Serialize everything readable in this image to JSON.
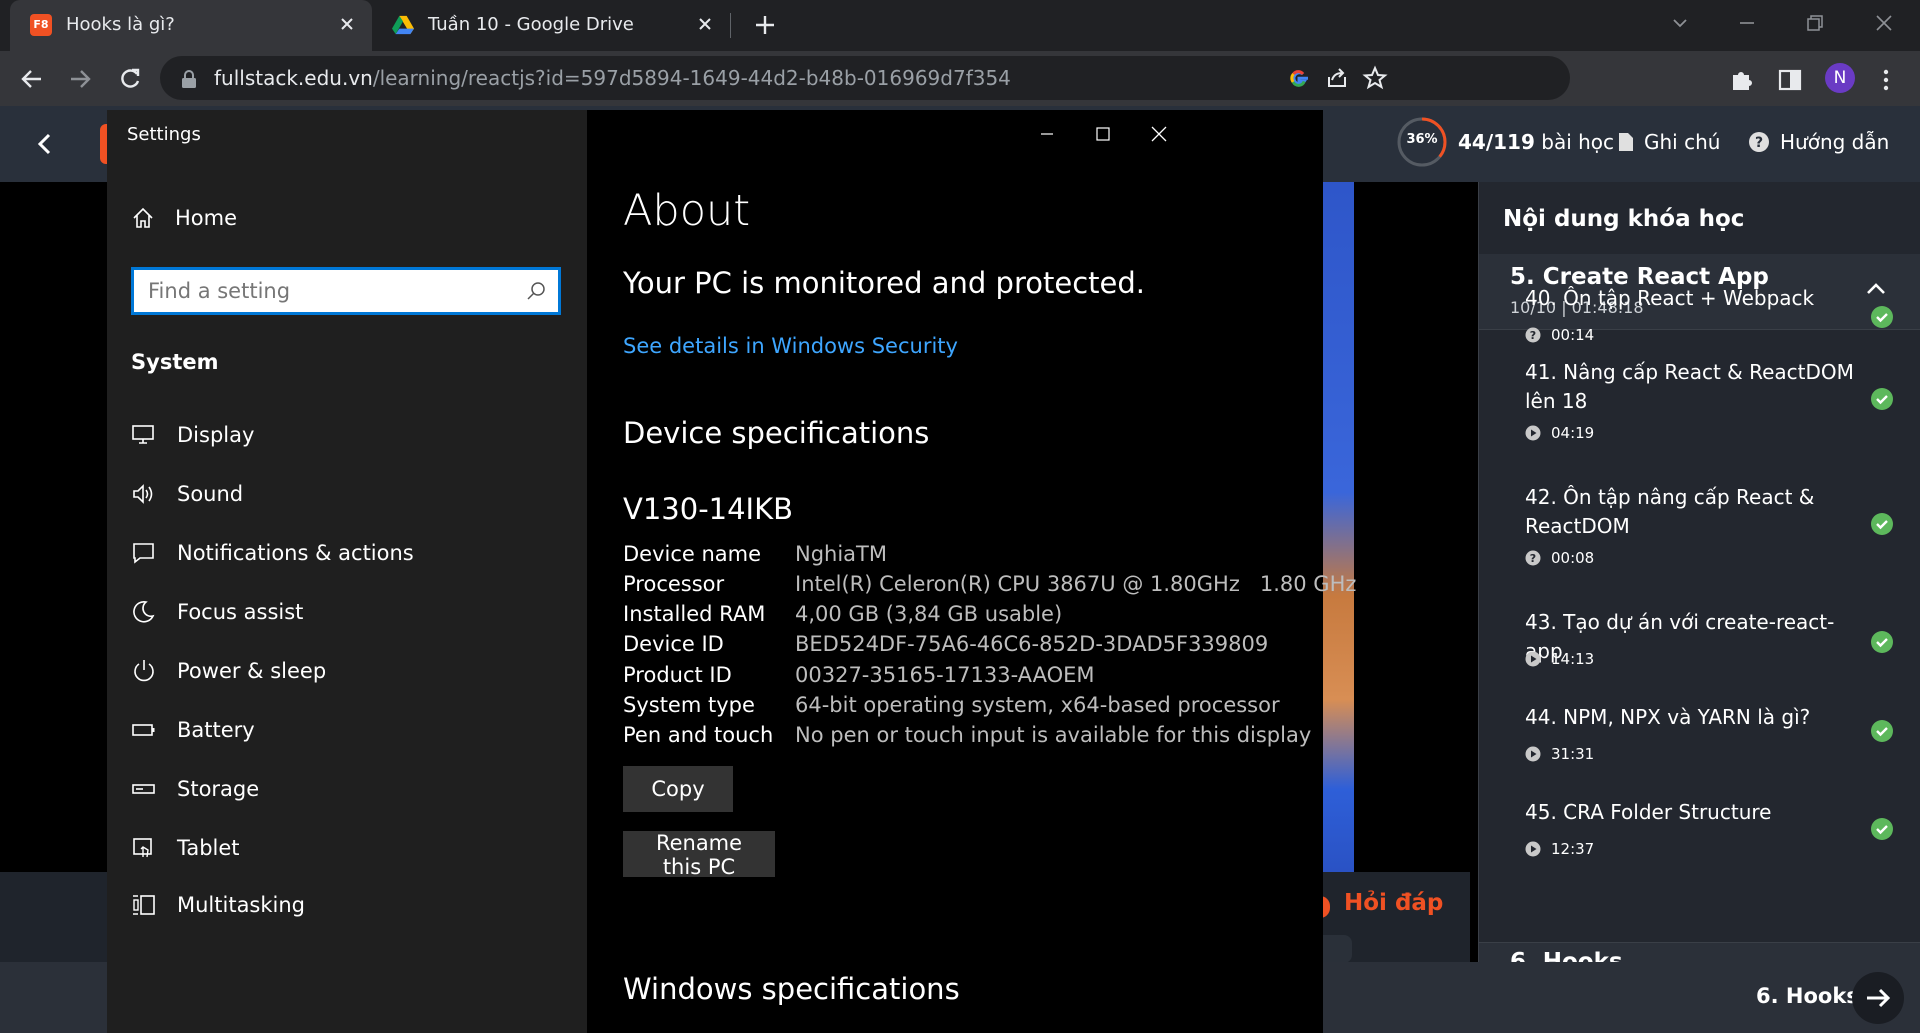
{
  "browser": {
    "tabs": [
      {
        "title": "Hooks là gì?",
        "favicon": "f8-favicon",
        "favicon_text": "F8",
        "active": true
      },
      {
        "title": "Tuần 10 - Google Drive",
        "favicon": "google-drive-favicon",
        "active": false
      }
    ],
    "url": {
      "host": "fullstack.edu.vn",
      "path": "/learning/reactjs?id=597d5894-1649-44d2-b48b-016969d7f354"
    },
    "profile_initial": "N"
  },
  "page": {
    "progress": {
      "percent_label": "36%",
      "percent": 36
    },
    "lesson_count": {
      "done": "44/119",
      "suffix": " bài học"
    },
    "header_links": {
      "notes": "Ghi chú",
      "guide": "Hướng dẫn"
    },
    "qa_label": "Hỏi đáp",
    "next_section_label": "6. Hooks",
    "course": {
      "title": "Nội dung khóa học",
      "section": {
        "name": "5. Create React App",
        "meta": "10/10 | 01:48:18"
      },
      "lessons": [
        {
          "title": "40. Ôn tập React + Webpack",
          "time": "00:14",
          "icon": "question-icon",
          "done": true
        },
        {
          "title": "41. Nâng cấp React & ReactDOM lên 18",
          "time": "04:19",
          "icon": "play-icon",
          "done": true
        },
        {
          "title": "42. Ôn tập nâng cấp React & ReactDOM",
          "time": "00:08",
          "icon": "question-icon",
          "done": true
        },
        {
          "title": "43. Tạo dự án với create-react-app",
          "time": "14:13",
          "icon": "play-icon",
          "done": true
        },
        {
          "title": "44. NPM, NPX và YARN là gì?",
          "time": "31:31",
          "icon": "play-icon",
          "done": true
        },
        {
          "title": "45. CRA Folder Structure",
          "time": "12:37",
          "icon": "play-icon",
          "done": true
        }
      ],
      "next_section_name": "6. Hooks"
    },
    "colors": {
      "brand": "#f05123",
      "check": "#5db85c",
      "link": "#3ea6ff",
      "accent": "#0078d7"
    }
  },
  "settings": {
    "app_title": "Settings",
    "home_label": "Home",
    "search_placeholder": "Find a setting",
    "section_label": "System",
    "nav_items": [
      {
        "label": "Display",
        "icon": "display-icon"
      },
      {
        "label": "Sound",
        "icon": "sound-icon"
      },
      {
        "label": "Notifications & actions",
        "icon": "notifications-icon"
      },
      {
        "label": "Focus assist",
        "icon": "focus-assist-icon"
      },
      {
        "label": "Power & sleep",
        "icon": "power-icon"
      },
      {
        "label": "Battery",
        "icon": "battery-icon"
      },
      {
        "label": "Storage",
        "icon": "storage-icon"
      },
      {
        "label": "Tablet",
        "icon": "tablet-icon"
      },
      {
        "label": "Multitasking",
        "icon": "multitasking-icon"
      }
    ],
    "about": {
      "heading": "About",
      "status": "Your PC is monitored and protected.",
      "security_link": "See details in Windows Security",
      "device_spec_heading": "Device specifications",
      "model": "V130-14IKB",
      "specs": [
        {
          "key": "Device name",
          "value": "NghiaTM"
        },
        {
          "key": "Processor",
          "value": "Intel(R) Celeron(R) CPU 3867U @ 1.80GHz   1.80 GHz"
        },
        {
          "key": "Installed RAM",
          "value": "4,00 GB (3,84 GB usable)"
        },
        {
          "key": "Device ID",
          "value": "BED524DF-75A6-46C6-852D-3DAD5F339809"
        },
        {
          "key": "Product ID",
          "value": "00327-35165-17133-AAOEM"
        },
        {
          "key": "System type",
          "value": "64-bit operating system, x64-based processor"
        },
        {
          "key": "Pen and touch",
          "value": "No pen or touch input is available for this display"
        }
      ],
      "copy_label": "Copy",
      "rename_label": "Rename this PC",
      "windows_spec_heading": "Windows specifications"
    }
  }
}
